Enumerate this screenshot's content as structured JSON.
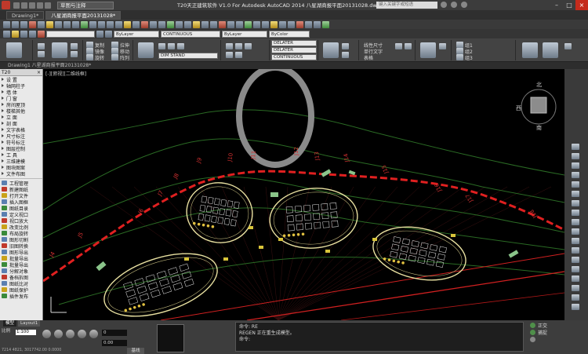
{
  "titlebar": {
    "workspace": "草图与注释",
    "title": "T20天正建筑软件 V1.0 For Autodesk AutoCAD 2014    八星湖商报平面20131028.dwg",
    "search_placeholder": "键入关键字或短语"
  },
  "doc_tabs": [
    "Drawing1*",
    "八星湖商报平面20131028*"
  ],
  "toolbar": {
    "bylayer": "ByLayer",
    "linetype": "CONTINUOUS",
    "lineweight": "ByLayer",
    "plotstyle": "ByColor"
  },
  "ribbon": {
    "btn_copy": "复制",
    "btn_mirror": "镜像",
    "btn_rotate": "旋转",
    "btn_stretch": "拉伸",
    "btn_move": "移动",
    "btn_array": "阵列",
    "layer_name": "DIM STAND",
    "layer1": "DELATER",
    "layer2": "DELATER",
    "layer3": "CONTINUOUS",
    "dim_label": "线性尺寸",
    "text_label": "单行文字",
    "table_label": "表格",
    "grp1": "组1",
    "grp2": "组2",
    "grp3": "组3"
  },
  "panel_strip": "Drawing1  八星湖商报平面20131028*",
  "palette": {
    "title": "T20",
    "items": [
      {
        "label": "设  置",
        "icon": "tri"
      },
      {
        "label": "轴网柱子",
        "icon": "tri"
      },
      {
        "label": "墙  体",
        "icon": "tri"
      },
      {
        "label": "门  窗",
        "icon": "tri"
      },
      {
        "label": "房间屋顶",
        "icon": "tri"
      },
      {
        "label": "楼梯其他",
        "icon": "tri"
      },
      {
        "label": "立  面",
        "icon": "tri"
      },
      {
        "label": "剖  面",
        "icon": "tri"
      },
      {
        "label": "文字表格",
        "icon": "tri"
      },
      {
        "label": "尺寸标注",
        "icon": "tri"
      },
      {
        "label": "符号标注",
        "icon": "tri"
      },
      {
        "label": "图层控制",
        "icon": "tri"
      },
      {
        "label": "工  具",
        "icon": "tri"
      },
      {
        "label": "三维建模",
        "icon": "tri"
      },
      {
        "label": "图块图案",
        "icon": "tri"
      },
      {
        "label": "文件布图",
        "icon": "tri"
      },
      {
        "label": "工程管理",
        "icon": "ic"
      },
      {
        "label": "新建图纸",
        "icon": "ic r"
      },
      {
        "label": "打开文件",
        "icon": "ic y"
      },
      {
        "label": "插入图框",
        "icon": "ic"
      },
      {
        "label": "图纸目录",
        "icon": "ic g"
      },
      {
        "label": "定义视口",
        "icon": "ic"
      },
      {
        "label": "视口放大",
        "icon": "ic r"
      },
      {
        "label": "改变比例",
        "icon": "ic y"
      },
      {
        "label": "布局旋转",
        "icon": "ic g"
      },
      {
        "label": "图形切割",
        "icon": "ic"
      },
      {
        "label": "旧图转换",
        "icon": "ic r"
      },
      {
        "label": "图形导出",
        "icon": "ic"
      },
      {
        "label": "批量导出",
        "icon": "ic y"
      },
      {
        "label": "批量导出",
        "icon": "ic g"
      },
      {
        "label": "分解对象",
        "icon": "ic"
      },
      {
        "label": "备档拆图",
        "icon": "ic r"
      },
      {
        "label": "图纸比对",
        "icon": "ic"
      },
      {
        "label": "图纸保护",
        "icon": "ic y"
      },
      {
        "label": "插件发布",
        "icon": "ic g"
      }
    ]
  },
  "drawing": {
    "view_label": "[-][俯视][二维线框]",
    "view_cube_top": "北",
    "view_cube_left": "西",
    "view_cube_bottom": "南",
    "axis_labels": [
      "J4",
      "J5",
      "J6",
      "J7",
      "J8",
      "J9",
      "J10",
      "J11",
      "J12",
      "J13",
      "J14",
      "J15",
      "J16",
      "J17",
      "J18"
    ]
  },
  "bottom": {
    "tabs": [
      "模型",
      "Layout1"
    ],
    "scale_label": "比例",
    "scale_value": "1:100",
    "coords": "7214 4821, 3017742.00 0.0000",
    "field_a": "0.00",
    "field_b": "0",
    "btn": "基线",
    "cmd_line1": "命令: RE",
    "cmd_line2": "REGEN  正在重生成模型。",
    "cmd_prompt": "命令:",
    "status_right": [
      {
        "label": "正交",
        "on": true
      },
      {
        "label": "捕捉",
        "on": true
      },
      {
        "label": "",
        "on": false
      }
    ]
  },
  "colors": {
    "grid": "#2a6a24",
    "red_boundary": "#e02020",
    "building": "#e8e0a0",
    "green_bar": "#8ac48a"
  }
}
